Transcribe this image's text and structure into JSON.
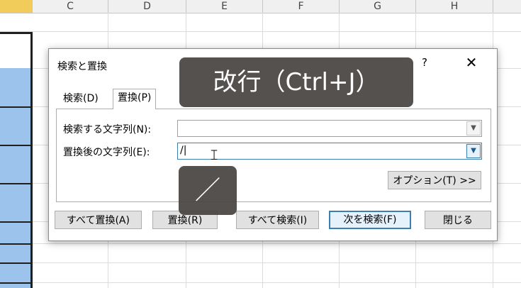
{
  "spreadsheet": {
    "columns": [
      "C",
      "D",
      "E",
      "F",
      "G",
      "H"
    ]
  },
  "dialog": {
    "title": "検索と置換",
    "help": "?",
    "close": "✕",
    "tabs": {
      "find": "検索(D)",
      "replace": "置換(P)"
    },
    "find_label": "検索する文字列(N):",
    "find_value": "",
    "replace_label": "置換後の文字列(E):",
    "replace_value": "/|",
    "combo_arrow": "▼",
    "buttons": {
      "options": "オプション(T) >>",
      "replace_all": "すべて置換(A)",
      "replace": "置換(R)",
      "find_all": "すべて検索(I)",
      "find_next": "次を検索(F)",
      "close": "閉じる"
    }
  },
  "overlays": {
    "shortcut": "改行（Ctrl+J）",
    "slash": "／"
  },
  "colors": {
    "selection_blue": "#9bc3ec",
    "selected_column_header": "#f2cc5a",
    "overlay_bg": "#484442",
    "focus_border": "#3c7fb1"
  }
}
